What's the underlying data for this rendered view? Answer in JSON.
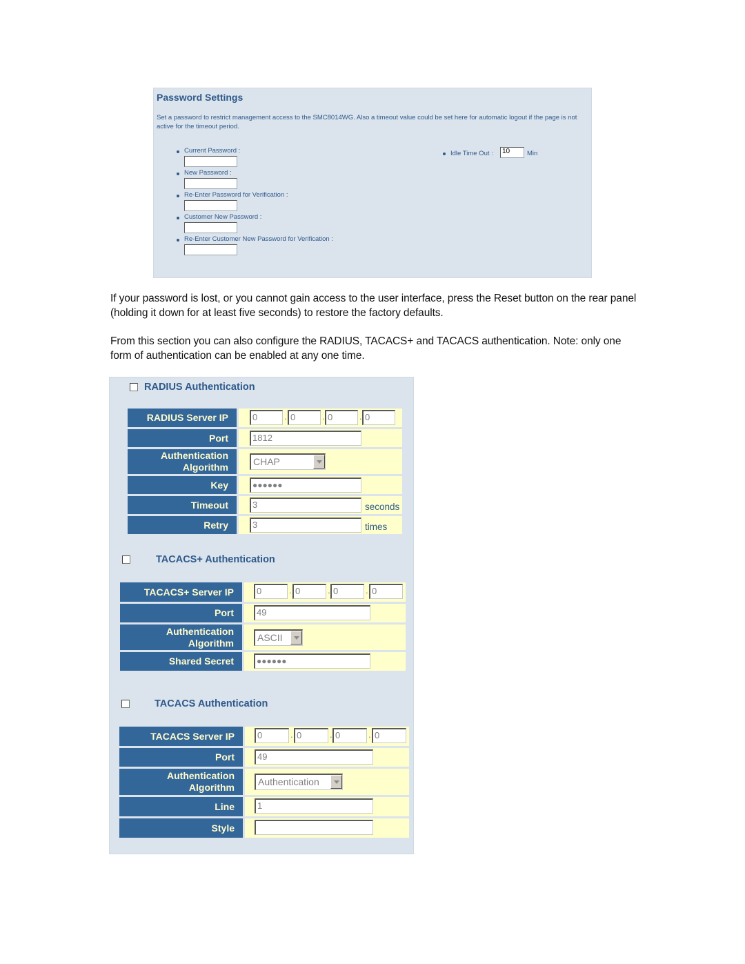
{
  "password_settings": {
    "title": "Password Settings",
    "description": "Set a password to restrict management access to the SMC8014WG. Also a timeout value could be set here for automatic logout if the page is not active for the timeout period.",
    "fields": [
      {
        "label": "Current Password :",
        "value": ""
      },
      {
        "label": "New Password :",
        "value": ""
      },
      {
        "label": "Re-Enter Password for Verification :",
        "value": ""
      },
      {
        "label": "Customer New Password :",
        "value": ""
      },
      {
        "label": "Re-Enter Customer New Password for Verification :",
        "value": ""
      }
    ],
    "idle_timeout": {
      "label": "Idle Time Out :",
      "value": "10",
      "unit": "Min"
    }
  },
  "paragraphs": [
    "If your password is lost, or you cannot gain access to the user interface, press the Reset button on the rear panel (holding it down for at least five seconds) to restore the factory defaults.",
    "From this section you can also configure the RADIUS, TACACS+ and TACACS authentication. Note: only one form of authentication can be enabled at any one time."
  ],
  "radius": {
    "title": "RADIUS Authentication",
    "enabled": false,
    "server_ip_label": "RADIUS Server IP",
    "server_ip": [
      "0",
      "0",
      "0",
      "0"
    ],
    "port_label": "Port",
    "port": "1812",
    "algorithm_label_1": "Authentication",
    "algorithm_label_2": "Algorithm",
    "algorithm": "CHAP",
    "key_label": "Key",
    "key": "●●●●●●",
    "timeout_label": "Timeout",
    "timeout": "3",
    "timeout_unit": "seconds",
    "retry_label": "Retry",
    "retry": "3",
    "retry_unit": "times"
  },
  "tacacs_plus": {
    "title": "TACACS+ Authentication",
    "enabled": false,
    "server_ip_label": "TACACS+ Server IP",
    "server_ip": [
      "0",
      "0",
      "0",
      "0"
    ],
    "port_label": "Port",
    "port": "49",
    "algorithm_label_1": "Authentication",
    "algorithm_label_2": "Algorithm",
    "algorithm": "ASCII",
    "secret_label": "Shared Secret",
    "secret": "●●●●●●"
  },
  "tacacs": {
    "title": "TACACS Authentication",
    "enabled": false,
    "server_ip_label": "TACACS Server IP",
    "server_ip": [
      "0",
      "0",
      "0",
      "0"
    ],
    "port_label": "Port",
    "port": "49",
    "algorithm_label_1": "Authentication",
    "algorithm_label_2": "Algorithm",
    "algorithm": "Authentication",
    "line_label": "Line",
    "line": "1",
    "style_label": "Style",
    "style": ""
  },
  "ip_separator": "."
}
